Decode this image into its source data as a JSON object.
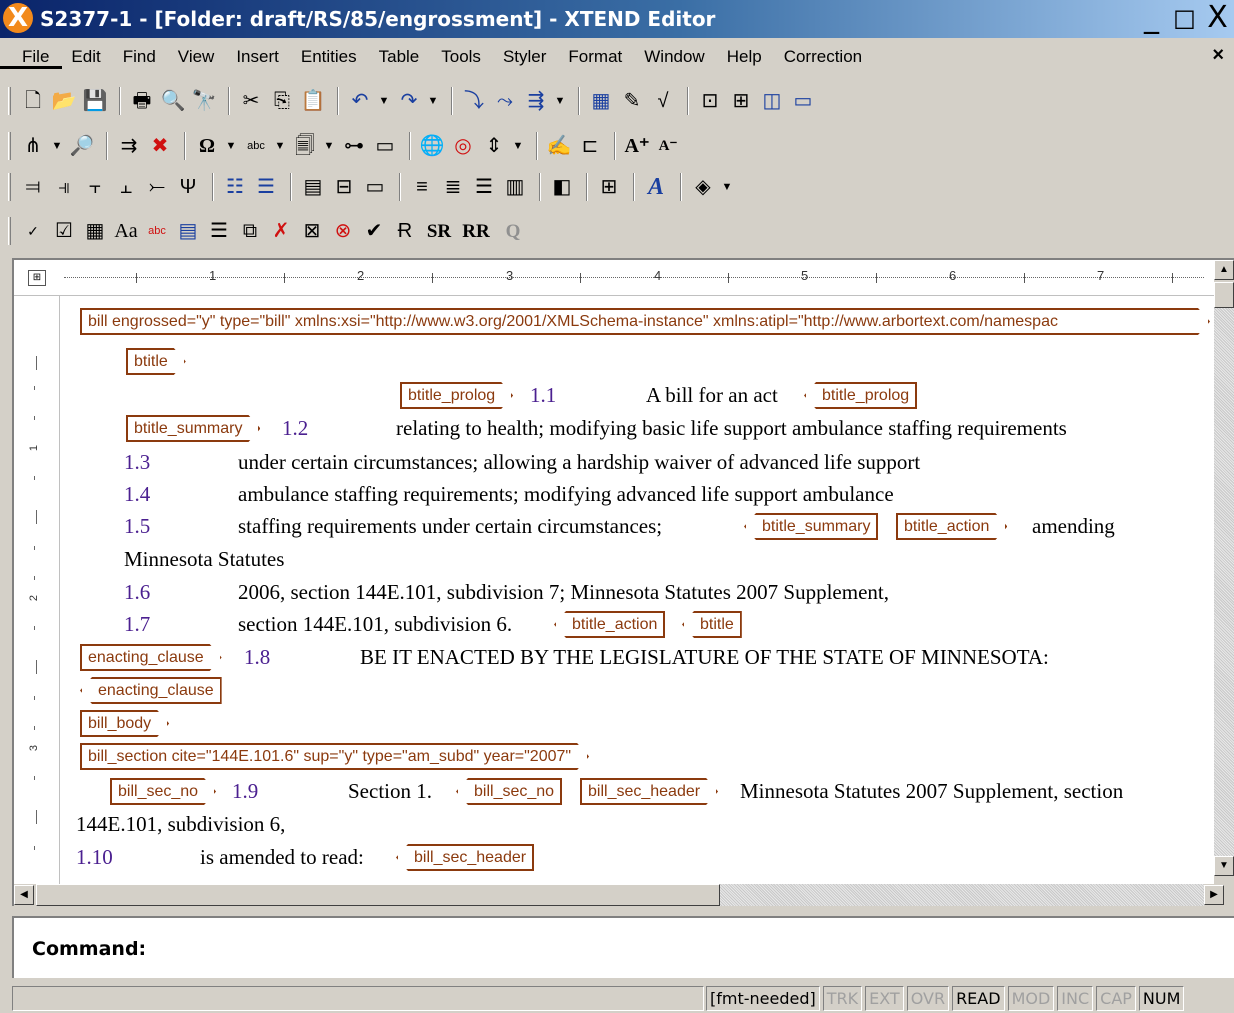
{
  "window": {
    "title": "S2377-1 - [Folder: draft/RS/85/engrossment] - XTEND Editor",
    "logo_letter": "X",
    "buttons": [
      "_",
      "□",
      "X"
    ]
  },
  "menu": {
    "items": [
      "File",
      "Edit",
      "Find",
      "View",
      "Insert",
      "Entities",
      "Table",
      "Tools",
      "Styler",
      "Format",
      "Window",
      "Help",
      "Correction"
    ],
    "close": "×"
  },
  "toolbars": {
    "text_buttons": [
      "SR",
      "RR",
      "Q"
    ]
  },
  "ruler": {
    "numbers": [
      "1",
      "2",
      "3",
      "4",
      "5",
      "6",
      "7"
    ],
    "vnumbers": [
      "1",
      "2",
      "3"
    ]
  },
  "document": {
    "root_tag": "bill engrossed=\"y\" type=\"bill\" xmlns:xsi=\"http://www.w3.org/2001/XMLSchema-instance\" xmlns:atipl=\"http://www.arbortext.com/namespac",
    "tags": {
      "btitle": "btitle",
      "btitle_prolog": "btitle_prolog",
      "btitle_summary": "btitle_summary",
      "btitle_action": "btitle_action",
      "enacting_clause": "enacting_clause",
      "bill_body": "bill_body",
      "bill_section": "bill_section cite=\"144E.101.6\" sup=\"y\" type=\"am_subd\" year=\"2007\"",
      "bill_sec_no": "bill_sec_no",
      "bill_sec_header": "bill_sec_header"
    },
    "line_numbers": [
      "1.1",
      "1.2",
      "1.3",
      "1.4",
      "1.5",
      "1.6",
      "1.7",
      "1.8",
      "1.9",
      "1.10"
    ],
    "text": {
      "l1_1": "A bill for an act",
      "l1_2": "relating to health; modifying basic life support ambulance staffing requirements",
      "l1_3": "under certain circumstances; allowing a hardship waiver of advanced life support",
      "l1_4": "ambulance staffing requirements; modifying advanced life support ambulance",
      "l1_5a": "staffing requirements under certain circumstances;",
      "l1_5b": "amending",
      "l1_5c": "Minnesota Statutes",
      "l1_6": "2006, section 144E.101, subdivision 7; Minnesota Statutes 2007 Supplement,",
      "l1_7": "section 144E.101, subdivision 6.",
      "l1_8": "BE IT ENACTED BY THE LEGISLATURE OF THE STATE OF MINNESOTA:",
      "l1_9a": "Section 1.",
      "l1_9b": "Minnesota Statutes 2007 Supplement, section",
      "l1_9c": "144E.101, subdivision 6,",
      "l1_10": "is amended to read:"
    }
  },
  "command": {
    "label": "Command:"
  },
  "status": {
    "cells": [
      {
        "label": "[fmt-needed]",
        "active": true
      },
      {
        "label": "TRK",
        "active": false
      },
      {
        "label": "EXT",
        "active": false
      },
      {
        "label": "OVR",
        "active": false
      },
      {
        "label": "READ",
        "active": true
      },
      {
        "label": "MOD",
        "active": false
      },
      {
        "label": "INC",
        "active": false
      },
      {
        "label": "CAP",
        "active": false
      },
      {
        "label": "NUM",
        "active": true
      }
    ]
  },
  "colors": {
    "tag_border": "#8b3a0e",
    "line_number": "#4b2090",
    "title_bar": "#0a246a"
  }
}
